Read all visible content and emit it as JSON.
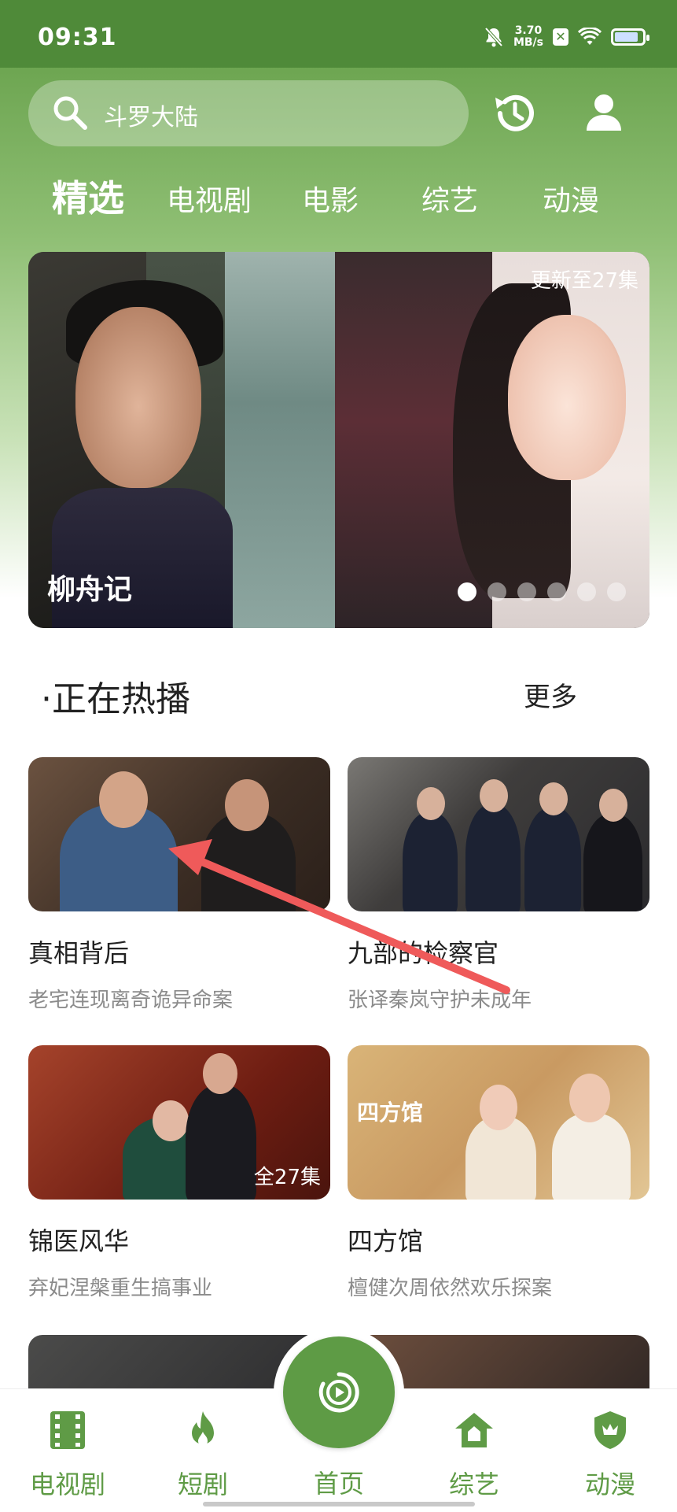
{
  "status_bar": {
    "time": "09:31",
    "net_speed_value": "3.70",
    "net_speed_unit": "MB/s",
    "battery_level": 0.85
  },
  "search": {
    "placeholder": "斗罗大陆"
  },
  "tabs": [
    {
      "label": "精选",
      "active": true
    },
    {
      "label": "电视剧"
    },
    {
      "label": "电影"
    },
    {
      "label": "综艺"
    },
    {
      "label": "动漫"
    }
  ],
  "banner": {
    "title": "柳舟记",
    "update_text": "更新至27集",
    "dot_count": 6,
    "active_dot": 0
  },
  "section": {
    "title": "·正在热播",
    "more": "更多"
  },
  "cards": [
    {
      "title": "真相背后",
      "subtitle": "老宅连现离奇诡异命案"
    },
    {
      "title": "九部的检察官",
      "subtitle": "张译秦岚守护未成年"
    },
    {
      "title": "锦医风华",
      "subtitle": "弃妃涅槃重生搞事业",
      "badge": "全27集"
    },
    {
      "title": "四方馆",
      "subtitle": "檀健次周依然欢乐探案",
      "thumb_text": "四方馆"
    }
  ],
  "bottom_nav": {
    "items": [
      {
        "label": "电视剧",
        "icon": "film-strip-icon"
      },
      {
        "label": "短剧",
        "icon": "flame-icon"
      },
      {
        "label": "首页",
        "icon": "play-circle-icon"
      },
      {
        "label": "综艺",
        "icon": "house-icon"
      },
      {
        "label": "动漫",
        "icon": "shield-icon"
      }
    ]
  },
  "colors": {
    "primary_green": "#5e9b45",
    "annotation_arrow": "#ef5a5a"
  }
}
